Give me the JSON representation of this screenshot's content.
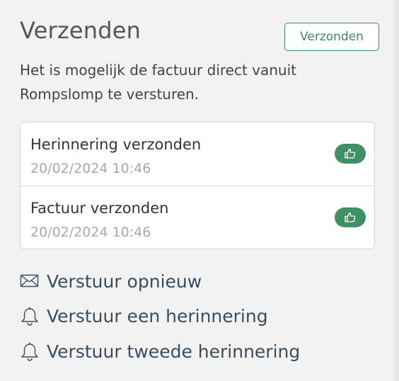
{
  "section": {
    "title": "Verzenden",
    "status_button_label": "Verzonden",
    "description_line1": "Het is mogelijk de factuur direct vanuit",
    "description_line2": "Rompslomp te versturen."
  },
  "events": [
    {
      "title": "Herinnering verzonden",
      "timestamp": "20/02/2024 10:46",
      "icon": "thumbs-up-icon"
    },
    {
      "title": "Factuur verzonden",
      "timestamp": "20/02/2024 10:46",
      "icon": "thumbs-up-icon"
    }
  ],
  "actions": [
    {
      "label": "Verstuur opnieuw",
      "icon": "envelope-icon"
    },
    {
      "label": "Verstuur een herinnering",
      "icon": "bell-icon"
    },
    {
      "label": "Verstuur tweede herinnering",
      "icon": "bell-icon"
    }
  ],
  "colors": {
    "accent": "#3f9163",
    "link": "#3a4d5e",
    "muted": "#a8a8a8",
    "background": "#f2f2f2"
  }
}
